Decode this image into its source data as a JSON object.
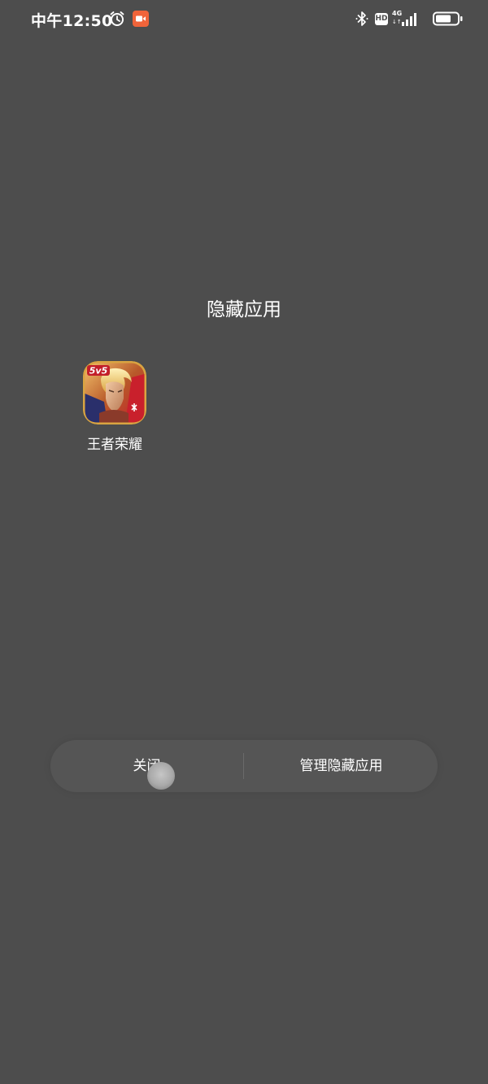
{
  "status_bar": {
    "time": "中午12:50",
    "network_type": "4G",
    "network_arrows": "↓↑",
    "hd_label": "HD",
    "battery_level": 0.72,
    "icons": [
      "alarm-icon",
      "screen-record-icon",
      "bluetooth-icon",
      "hd-icon",
      "signal-icon",
      "battery-icon"
    ],
    "record_color": "#f0643a"
  },
  "page": {
    "title": "隐藏应用"
  },
  "apps": [
    {
      "label": "王者荣耀",
      "badge": "5v5",
      "icon": "honor-of-kings-app-icon"
    }
  ],
  "actions": {
    "close_label": "关闭",
    "manage_label": "管理隐藏应用"
  },
  "colors": {
    "background": "#4d4d4d",
    "action_bar": "#555555",
    "text": "#ffffff"
  }
}
